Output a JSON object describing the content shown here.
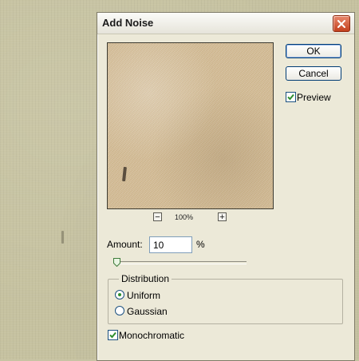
{
  "dialog": {
    "title": "Add Noise",
    "buttons": {
      "ok": "OK",
      "cancel": "Cancel"
    },
    "preview_toggle": {
      "label": "Preview",
      "checked": true
    },
    "zoom": {
      "minus": "−",
      "plus": "+",
      "level": "100%"
    },
    "amount": {
      "label": "Amount:",
      "value": "10",
      "unit": "%",
      "slider_fraction": 0.02
    },
    "distribution": {
      "title": "Distribution",
      "options": [
        {
          "label": "Uniform",
          "selected": true
        },
        {
          "label": "Gaussian",
          "selected": false
        }
      ]
    },
    "monochromatic": {
      "label": "Monochromatic",
      "checked": true
    }
  },
  "colors": {
    "dialog_bg": "#ece9d8",
    "close_button": "#c4411e",
    "check_mark": "#2f8f2f",
    "desktop_bg": "#c6c2a0",
    "preview_tone": "#d7c09a"
  },
  "icons": {
    "close": "close-icon",
    "check": "checkmark-icon"
  }
}
